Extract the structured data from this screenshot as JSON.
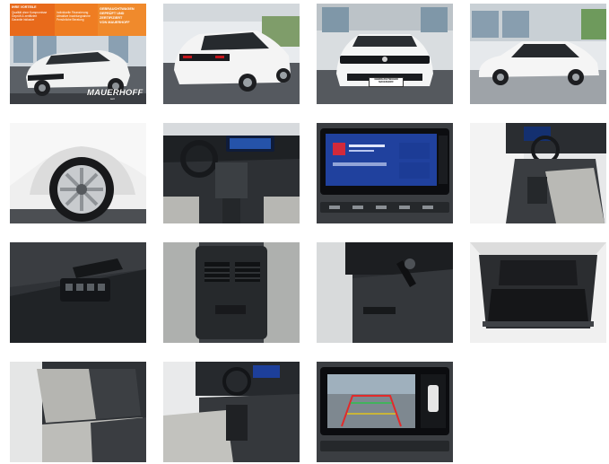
{
  "gallery": {
    "photos": [
      {
        "name": "front-three-quarter-showroom-banner"
      },
      {
        "name": "rear-three-quarter"
      },
      {
        "name": "front-view"
      },
      {
        "name": "side-view"
      },
      {
        "name": "wheel-closeup"
      },
      {
        "name": "dashboard-overview"
      },
      {
        "name": "infotainment-screen"
      },
      {
        "name": "front-seats-interior"
      },
      {
        "name": "door-window-controls"
      },
      {
        "name": "rear-air-vents"
      },
      {
        "name": "steering-column-gear-selector"
      },
      {
        "name": "open-trunk"
      },
      {
        "name": "rear-seats"
      },
      {
        "name": "passenger-side-interior"
      },
      {
        "name": "rear-camera-display"
      }
    ],
    "banner": {
      "head": "IHRE VORTEILE",
      "left": "Qualität ohne Kompromisse\nGeprüft & zertifiziert\nGarantie inklusive",
      "mid": "Individuelle Finanzierung\nAttraktive Inzahlungnahme\nPersönliche Beratung",
      "right": "GEBRAUCHTWAGEN\nGEPRÜFT UND ZERTIFIZIERT\nVON MAUERHOFF"
    },
    "brand": "MAUERHOFF",
    "brand_sub": "seit",
    "plate": "GEBRAUCHTWAGEN\nMAUERHOFF"
  }
}
